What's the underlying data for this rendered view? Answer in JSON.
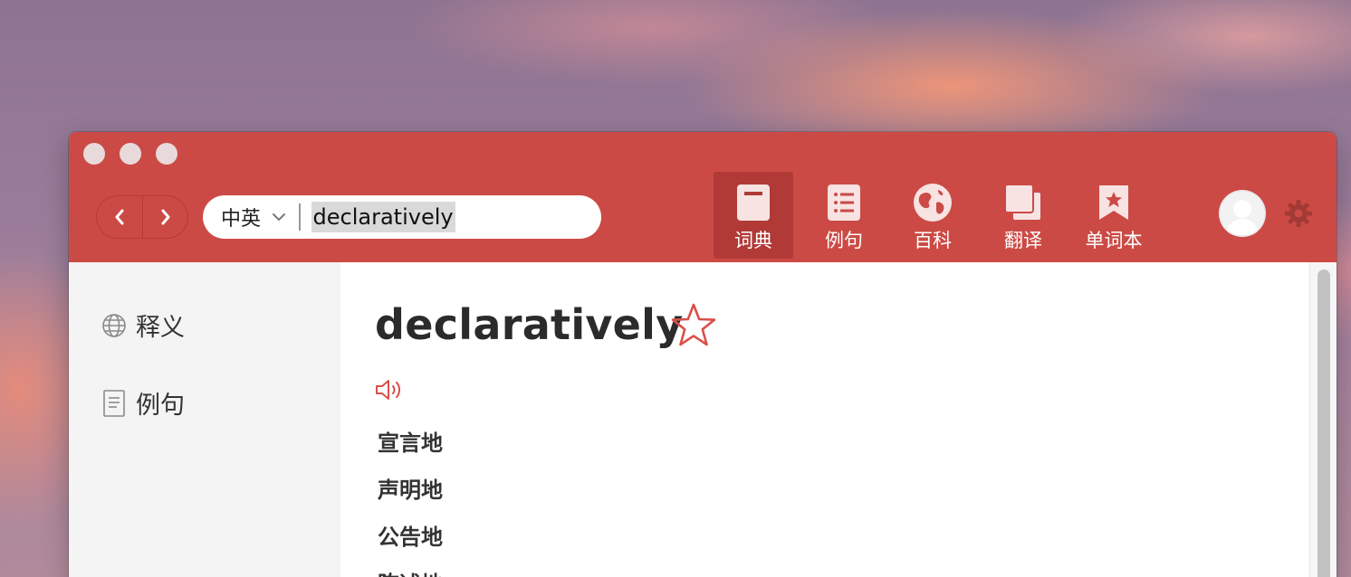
{
  "toolbar": {
    "lang_selector": "中英",
    "search_query": "declaratively",
    "tabs": [
      {
        "label": "词典",
        "icon": "book-icon"
      },
      {
        "label": "例句",
        "icon": "list-icon"
      },
      {
        "label": "百科",
        "icon": "globe-icon"
      },
      {
        "label": "翻译",
        "icon": "translate-icon"
      },
      {
        "label": "单词本",
        "icon": "bookmark-star-icon"
      }
    ],
    "active_tab": "词典"
  },
  "sidebar": {
    "items": [
      {
        "label": "释义",
        "icon": "globe-outline-icon"
      },
      {
        "label": "例句",
        "icon": "document-icon"
      }
    ]
  },
  "entry": {
    "word": "declaratively",
    "meanings": [
      "宣言地",
      "声明地",
      "公告地",
      "陈述地"
    ]
  },
  "colors": {
    "brand_red": "#cc4a45",
    "active_tab": "#b13a37",
    "sidebar_bg": "#f4f4f4"
  }
}
